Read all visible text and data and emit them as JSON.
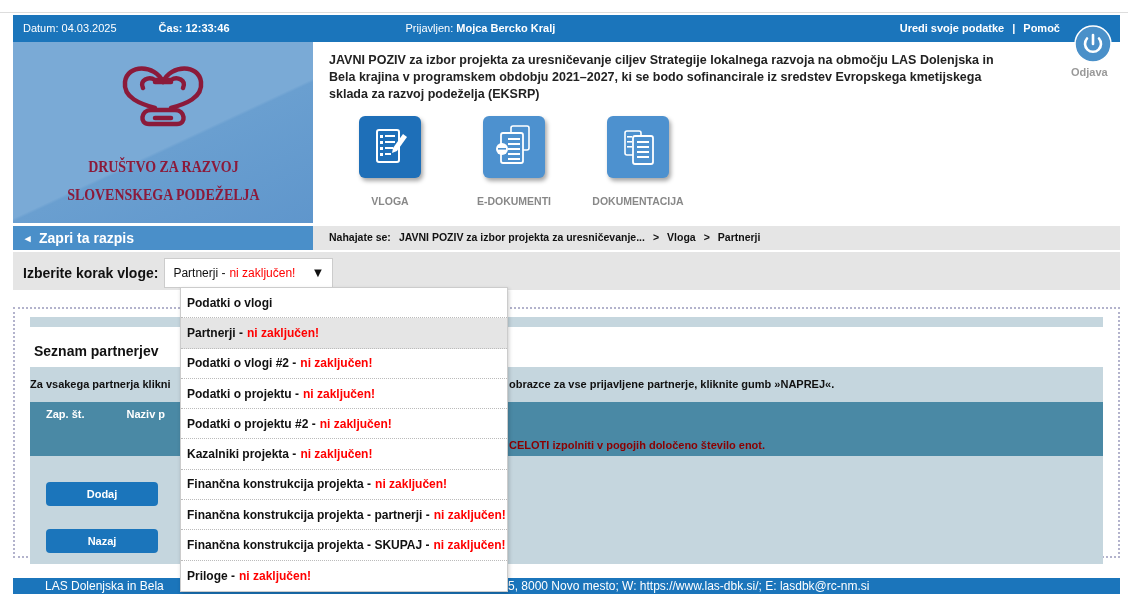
{
  "top_bar": {
    "date_label": "Datum:",
    "date": "04.03.2025",
    "time_label": "Čas:",
    "time": "12:33:46",
    "user_label": "Prijavljen:",
    "user": "Mojca Bercko Kralj",
    "links": [
      "Uredi svoje podatke",
      "Pomoč"
    ],
    "separator": "|"
  },
  "logout": {
    "label": "Odjava"
  },
  "logo": {
    "lines": [
      "DRUŠTVO ZA RAZVOJ",
      "SLOVENSKEGA PODEŽELJA"
    ]
  },
  "call_title": "JAVNI POZIV za izbor projekta za uresničevanje ciljev Strategije lokalnega razvoja na območju LAS Dolenjska in Bela krajina v programskem obdobju 2021–2027, ki se bodo sofinancirale iz sredstev Evropskega kmetijskega sklada za razvoj podeželja (EKSRP)",
  "nav_tiles": [
    {
      "label": "VLOGA",
      "kind": "form",
      "selected": true
    },
    {
      "label": "E-DOKUMENTI",
      "kind": "edocs",
      "selected": false
    },
    {
      "label": "DOKUMENTACIJA",
      "kind": "docs",
      "selected": false
    }
  ],
  "close_link": {
    "arrow": "◂",
    "label": "Zapri ta razpis"
  },
  "breadcrumb": {
    "label": "Nahajate se:",
    "separator": ">",
    "items": [
      "JAVNI POZIV za izbor projekta za uresničevanje...",
      "Vloga",
      "Partnerji"
    ]
  },
  "step_select": {
    "label": "Izberite korak vloge:",
    "value": "Partnerji -",
    "status": "ni zaključen!",
    "arrow": "▼",
    "options": [
      {
        "text": "Podatki o vlogi",
        "selected": false
      },
      {
        "text": "Partnerji -",
        "status": "ni zaključen!",
        "selected": true
      },
      {
        "text": "Podatki o vlogi #2 -",
        "status": "ni zaključen!",
        "selected": false
      },
      {
        "text": "Podatki o projektu -",
        "status": "ni zaključen!",
        "selected": false
      },
      {
        "text": "Podatki o projektu #2 -",
        "status": "ni zaključen!",
        "selected": false
      },
      {
        "text": "Kazalniki projekta -",
        "status": "ni zaključen!",
        "selected": false
      },
      {
        "text": "Finančna konstrukcija projekta -",
        "status": "ni zaključen!",
        "selected": false
      },
      {
        "text": "Finančna konstrukcija projekta - partnerji -",
        "status": "ni zaključen!",
        "selected": false
      },
      {
        "text": "Finančna konstrukcija projekta - SKUPAJ -",
        "status": "ni zaključen!",
        "selected": false
      },
      {
        "text": "Priloge -",
        "status": "ni zaključen!",
        "selected": false
      }
    ]
  },
  "partners": {
    "title": "Seznam partnerjev",
    "instruction_left": "Za vsakega partnerja klikni",
    "instruction_right": "obrazce za vse prijavljene partnerje, kliknite gumb »NAPREJ«.",
    "columns": [
      "Zap. št.",
      "Naziv p"
    ],
    "warning": "CELOTI izpolniti v pogojih določeno število enot.",
    "buttons": [
      "Dodaj",
      "Nazaj"
    ]
  },
  "footer": {
    "left": "LAS Dolenjska in Bela",
    "right": "5, 8000 Novo mesto; W: https://www.las-dbk.si/; E: lasdbk@rc-nm.si"
  }
}
